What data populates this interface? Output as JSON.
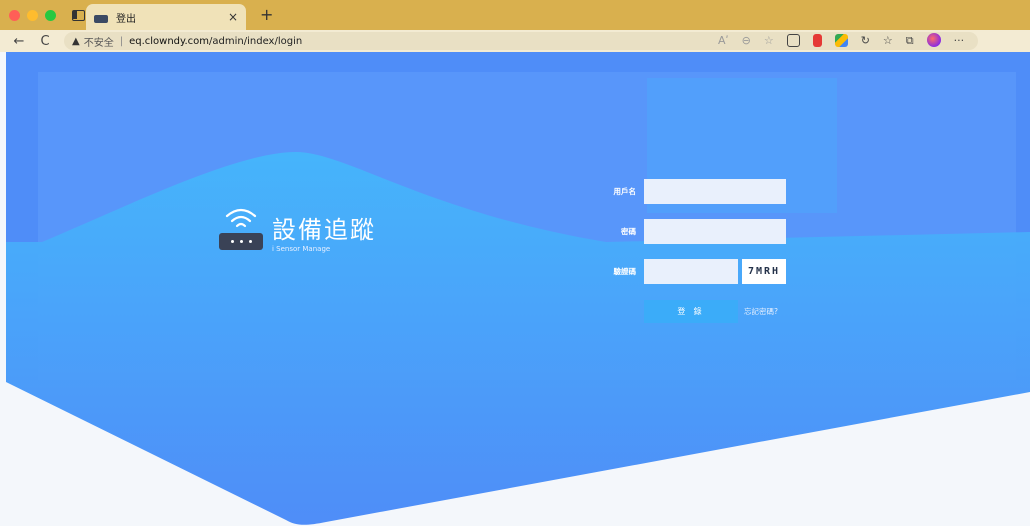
{
  "browser": {
    "tab": {
      "title": "登出",
      "close": "×"
    },
    "new_tab": "+",
    "nav": {
      "back": "←",
      "reload": "C"
    },
    "address": {
      "security_label": "不安全",
      "separator": "|",
      "host": "eq.clowndy.com",
      "path": "/admin/index/login"
    },
    "url_icons": [
      "Aʹ",
      "⊖",
      "☆"
    ],
    "more": "···"
  },
  "brand": {
    "title": "設備追蹤",
    "subtitle": "i Sensor Manage"
  },
  "login_form": {
    "username_label": "用戶名",
    "password_label": "密碼",
    "captcha_label": "驗證碼",
    "captcha_text": "7MRH",
    "submit_label": "登 錄",
    "forgot_label": "忘記密碼?"
  },
  "colors": {
    "page_bg": "#4f8df8",
    "panel": "#5896fa",
    "wave": "#44b4fb",
    "button": "#3bacf9",
    "tabbar": "#d9b04e"
  }
}
